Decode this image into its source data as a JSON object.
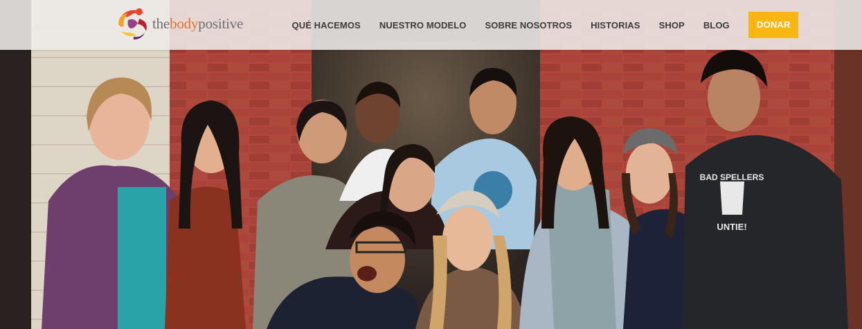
{
  "brand": {
    "word1": "the",
    "word2": "body",
    "word3": "positive",
    "logo_icon": "swirl-figure-logo-icon"
  },
  "nav": {
    "items": [
      {
        "label": "QUÉ HACEMOS"
      },
      {
        "label": "NUESTRO MODELO"
      },
      {
        "label": "SOBRE NOSOTROS"
      },
      {
        "label": "HISTORIAS"
      },
      {
        "label": "SHOP"
      },
      {
        "label": "BLOG"
      }
    ],
    "donate_label": "DONAR"
  },
  "hero": {
    "shirt_text_line1": "BAD SPELLERS",
    "shirt_text_line2": "UNTIE!",
    "description_icon": "group-photo"
  },
  "colors": {
    "accent": "#f7b614",
    "brand_orange": "#e07030",
    "header_bg": "#eeece9",
    "nav_text": "#3b3b3b",
    "brick": "#9c3b31"
  }
}
